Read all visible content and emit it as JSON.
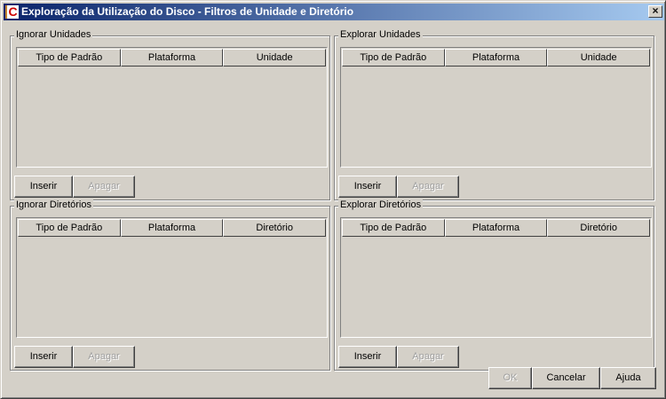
{
  "window": {
    "title": "Exploração da Utilização do Disco - Filtros de Unidade e Diretório",
    "close": "×"
  },
  "panels": [
    {
      "legend": "Ignorar Unidades",
      "columns": [
        "Tipo de Padrão",
        "Plataforma",
        "Unidade"
      ],
      "insert": "Inserir",
      "delete": "Apagar"
    },
    {
      "legend": "Explorar Unidades",
      "columns": [
        "Tipo de Padrão",
        "Plataforma",
        "Unidade"
      ],
      "insert": "Inserir",
      "delete": "Apagar"
    },
    {
      "legend": "Ignorar Diretórios",
      "columns": [
        "Tipo de Padrão",
        "Plataforma",
        "Diretório"
      ],
      "insert": "Inserir",
      "delete": "Apagar"
    },
    {
      "legend": "Explorar Diretórios",
      "columns": [
        "Tipo de Padrão",
        "Plataforma",
        "Diretório"
      ],
      "insert": "Inserir",
      "delete": "Apagar"
    }
  ],
  "footer": {
    "ok": "OK",
    "cancel": "Cancelar",
    "help": "Ajuda"
  }
}
